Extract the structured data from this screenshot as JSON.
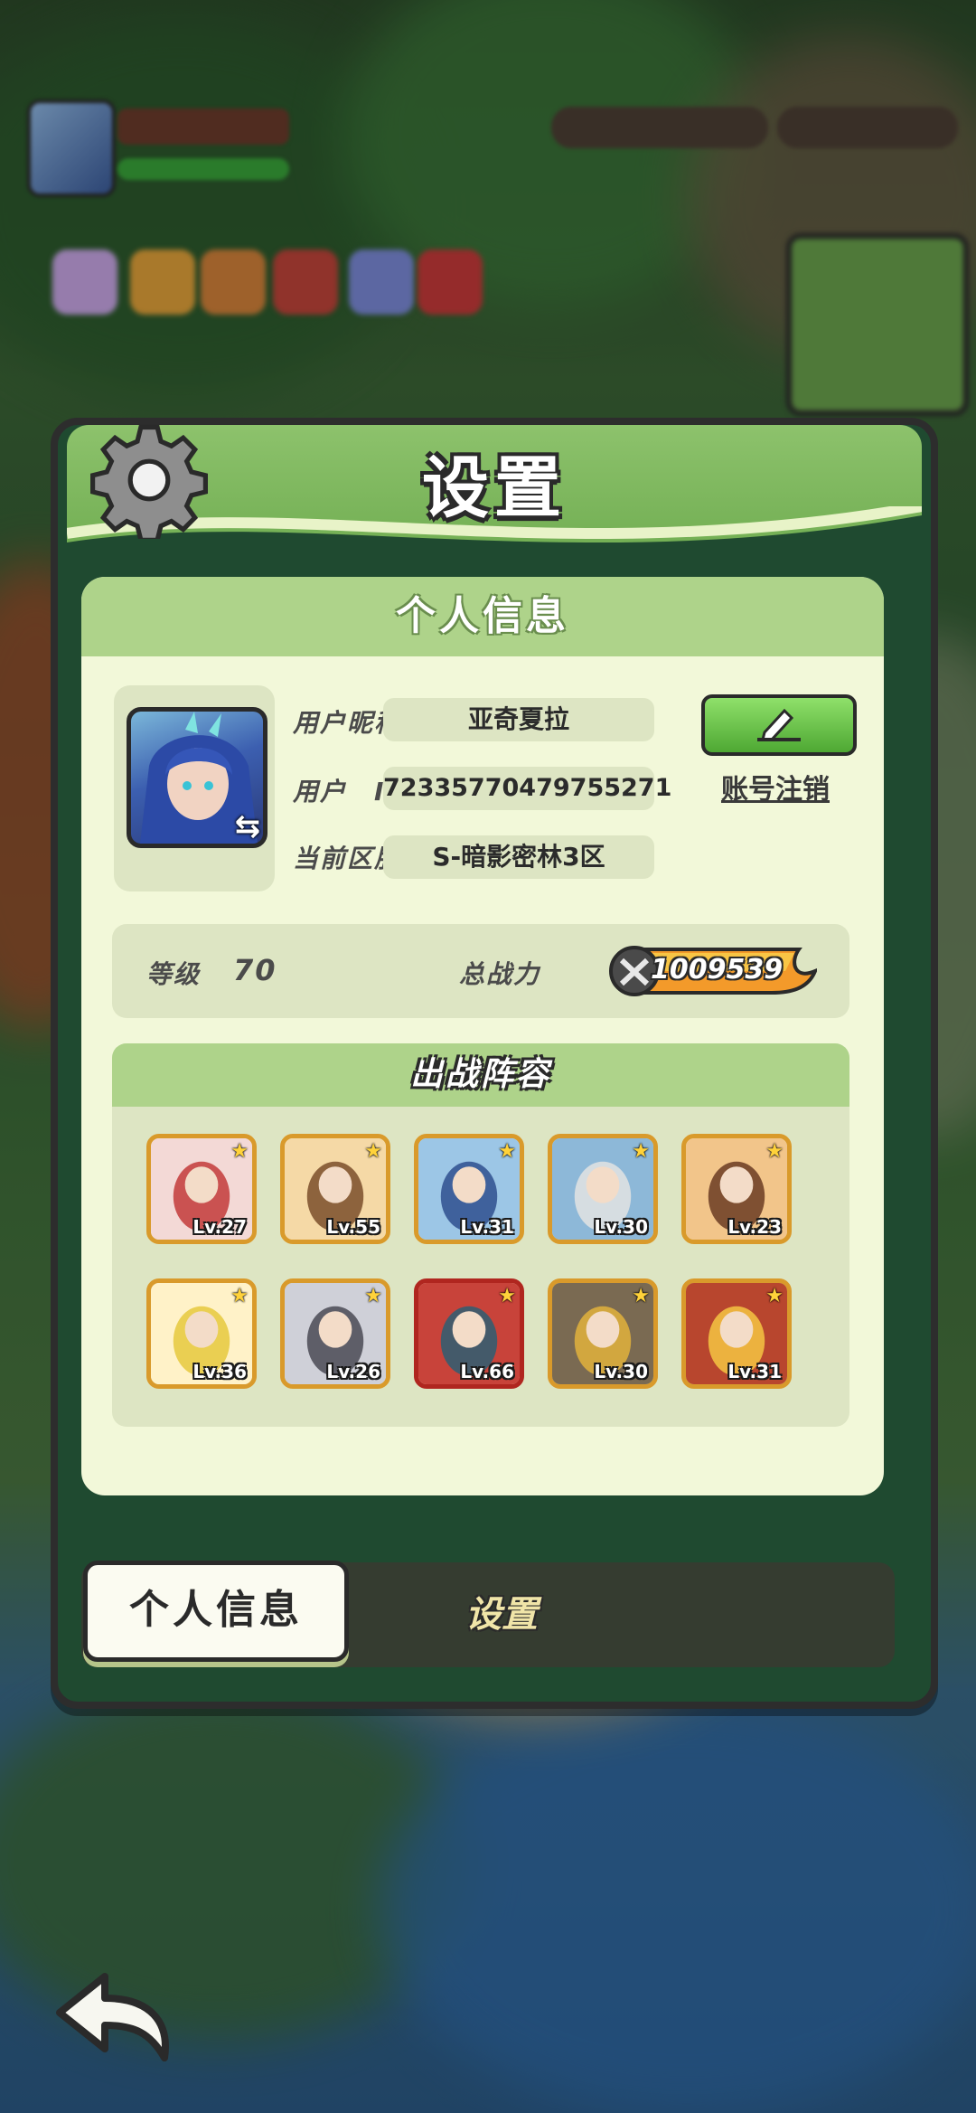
{
  "panel": {
    "title": "设置"
  },
  "profile": {
    "section_title": "个人信息",
    "nickname_label": "用户昵称",
    "nickname": "亚奇夏拉",
    "id_label": "用户　ID",
    "user_id": "72335770479755271",
    "server_label": "当前区服",
    "server": "S-暗影密林3区",
    "account_cancel": "账号注销"
  },
  "stats": {
    "level_label": "等级",
    "level": "70",
    "power_label": "总战力",
    "power": "1009539"
  },
  "lineup": {
    "title": "出战阵容",
    "heroes": [
      {
        "lv": "Lv.27",
        "color": "#f3d9d6",
        "accent": "#c23a3a",
        "frame": "gold"
      },
      {
        "lv": "Lv.55",
        "color": "#f5d9a6",
        "accent": "#7a4d2a",
        "frame": "gold"
      },
      {
        "lv": "Lv.31",
        "color": "#9cc6e6",
        "accent": "#2f4f8e",
        "frame": "gold"
      },
      {
        "lv": "Lv.30",
        "color": "#8db8d8",
        "accent": "#e3e3e3",
        "frame": "gold"
      },
      {
        "lv": "Lv.23",
        "color": "#f2c58a",
        "accent": "#6b3b22",
        "frame": "gold"
      },
      {
        "lv": "Lv.36",
        "color": "#fff2c8",
        "accent": "#e6c93d",
        "frame": "gold"
      },
      {
        "lv": "Lv.26",
        "color": "#cfd0d8",
        "accent": "#4a4a55",
        "frame": "gold"
      },
      {
        "lv": "Lv.66",
        "color": "#c8433a",
        "accent": "#2d5e73",
        "frame": "red"
      },
      {
        "lv": "Lv.30",
        "color": "#7a6a52",
        "accent": "#e2b23c",
        "frame": "gold"
      },
      {
        "lv": "Lv.31",
        "color": "#b8462e",
        "accent": "#f4c542",
        "frame": "gold"
      }
    ]
  },
  "tabs": {
    "active": "个人信息",
    "inactive": "设置"
  },
  "colors": {
    "panel_header": "#7ab85a",
    "card_bg": "#f2f8d9",
    "card_head": "#aed38a",
    "edit_button": "#6cc94a"
  }
}
